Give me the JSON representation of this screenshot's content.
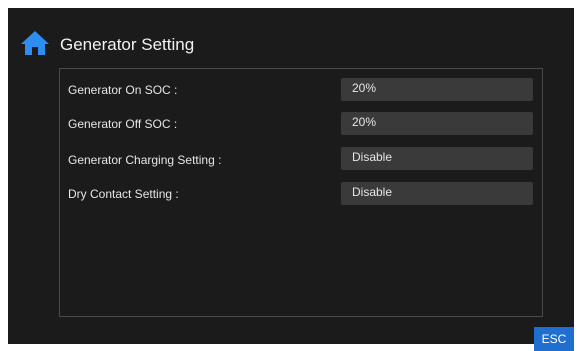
{
  "header": {
    "title": "Generator Setting",
    "icon": "home-icon"
  },
  "settings": [
    {
      "label": "Generator On SOC :",
      "value": "20%"
    },
    {
      "label": "Generator Off SOC :",
      "value": "20%"
    },
    {
      "label": "Generator Charging Setting :",
      "value": "Disable"
    },
    {
      "label": "Dry Contact Setting :",
      "value": "Disable"
    }
  ],
  "footer": {
    "esc_label": "ESC"
  },
  "colors": {
    "background": "#1b1b1b",
    "field": "#3a3a3a",
    "accent": "#1f6fd1"
  }
}
